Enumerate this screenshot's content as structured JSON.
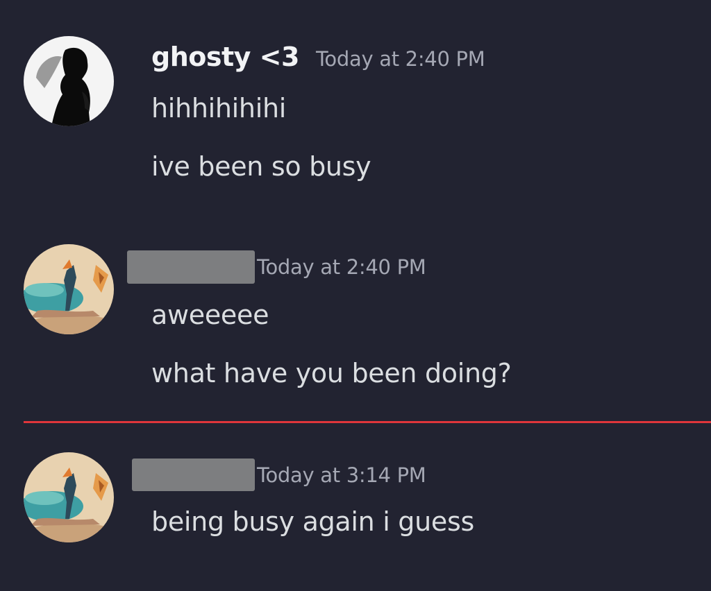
{
  "messages": [
    {
      "author": "ghosty <3",
      "timestamp": "Today at 2:40 PM",
      "lines": [
        "hihhihihihi",
        "ive been so busy"
      ]
    },
    {
      "author": "",
      "timestamp": "Today at 2:40 PM",
      "lines": [
        "aweeeee",
        "what have you been doing?"
      ]
    },
    {
      "author": "",
      "timestamp": "Today at 3:14 PM",
      "lines": [
        "being busy again i guess"
      ]
    }
  ],
  "colors": {
    "background": "#222331",
    "new_messages_divider": "#e0353b",
    "username": "#f2f3f5",
    "timestamp": "#a5a8b4",
    "message_text": "#dbdee1"
  }
}
